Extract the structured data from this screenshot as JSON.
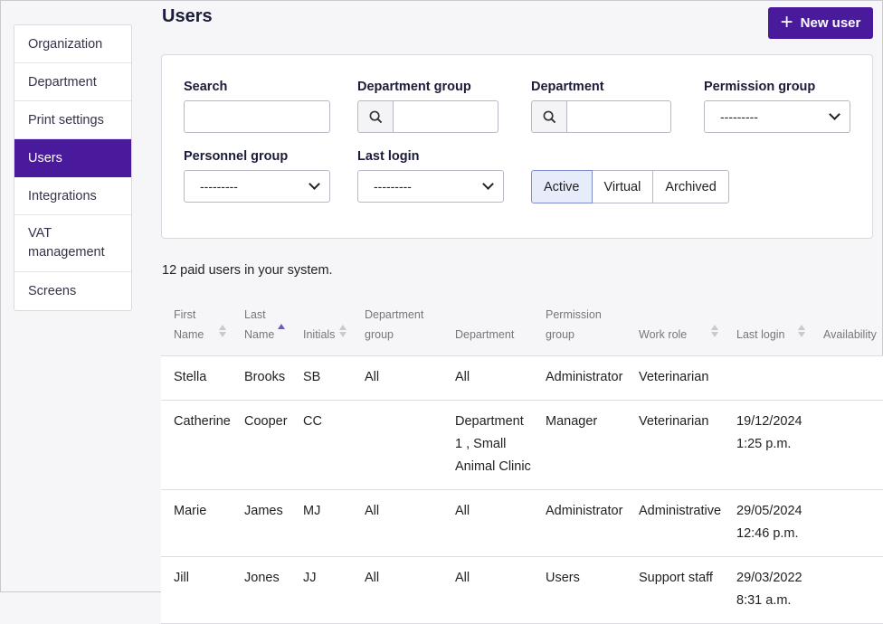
{
  "sidebar": {
    "items": [
      {
        "label": "Organization"
      },
      {
        "label": "Department"
      },
      {
        "label": "Print settings"
      },
      {
        "label": "Users"
      },
      {
        "label": "Integrations"
      },
      {
        "label": "VAT management"
      },
      {
        "label": "Screens"
      }
    ]
  },
  "header": {
    "title": "Users",
    "new_user_label": "New user"
  },
  "filters": {
    "search_label": "Search",
    "department_group_label": "Department group",
    "department_label": "Department",
    "permission_group_label": "Permission group",
    "permission_group_value": "---------",
    "personnel_group_label": "Personnel group",
    "personnel_group_value": "---------",
    "last_login_label": "Last login",
    "last_login_value": "---------",
    "status_tabs": [
      "Active",
      "Virtual",
      "Archived"
    ],
    "active_status": "Active"
  },
  "summary": "12 paid users in your system.",
  "table": {
    "columns": [
      {
        "line1": "First",
        "line2": "Name"
      },
      {
        "line1": "Last",
        "line2": "Name"
      },
      {
        "line1": "",
        "line2": "Initials"
      },
      {
        "line1": "Department",
        "line2": "group"
      },
      {
        "line1": "",
        "line2": "Department"
      },
      {
        "line1": "Permission",
        "line2": "group"
      },
      {
        "line1": "",
        "line2": "Work role"
      },
      {
        "line1": "",
        "line2": "Last login"
      },
      {
        "line1": "",
        "line2": "Availability"
      }
    ],
    "rows": [
      {
        "first": "Stella",
        "last": "Brooks",
        "initials": "SB",
        "dept_group": "All",
        "dept": "All",
        "perm": "Administrator",
        "role": "Veterinarian",
        "login_date": "",
        "login_time": "",
        "avail": ""
      },
      {
        "first": "Catherine",
        "last": "Cooper",
        "initials": "CC",
        "dept_group": "",
        "dept": "Department 1 , Small Animal Clinic",
        "perm": "Manager",
        "role": "Veterinarian",
        "login_date": "19/12/2024",
        "login_time": "1:25 p.m.",
        "avail": ""
      },
      {
        "first": "Marie",
        "last": "James",
        "initials": "MJ",
        "dept_group": "All",
        "dept": "All",
        "perm": "Administrator",
        "role": "Administrative",
        "login_date": "29/05/2024",
        "login_time": "12:46 p.m.",
        "avail": ""
      },
      {
        "first": "Jill",
        "last": "Jones",
        "initials": "JJ",
        "dept_group": "All",
        "dept": "All",
        "perm": "Users",
        "role": "Support staff",
        "login_date": "29/03/2022",
        "login_time": "8:31 a.m.",
        "avail": ""
      }
    ]
  },
  "colors": {
    "accent": "#4a1a9c",
    "active_tab_bg": "#e7ecfb"
  }
}
